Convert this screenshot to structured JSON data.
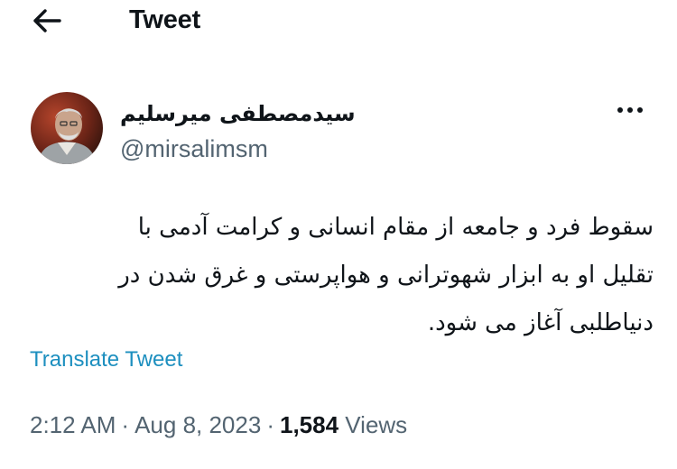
{
  "header": {
    "title": "Tweet",
    "back_icon": "arrow-left-icon"
  },
  "author": {
    "display_name": "سیدمصطفی میرسلیم",
    "handle": "@mirsalimsm",
    "avatar_icon": "user-avatar"
  },
  "more_icon": "more-horizontal-icon",
  "tweet": {
    "lines": [
      "سقوط فرد و جامعه از مقام انسانی و کرامت آدمی با",
      "تقلیل او به ابزار شهوترانی و هواپرستی و غرق شدن در",
      "دنیاطلبی آغاز می شود."
    ],
    "translate_label": "Translate Tweet"
  },
  "meta": {
    "time": "2:12 AM",
    "separator": "·",
    "date": "Aug 8, 2023",
    "views_count": "1,584",
    "views_label": "Views"
  },
  "colors": {
    "text": "#0f1419",
    "secondary": "#536471",
    "link": "#1d8fbf"
  }
}
